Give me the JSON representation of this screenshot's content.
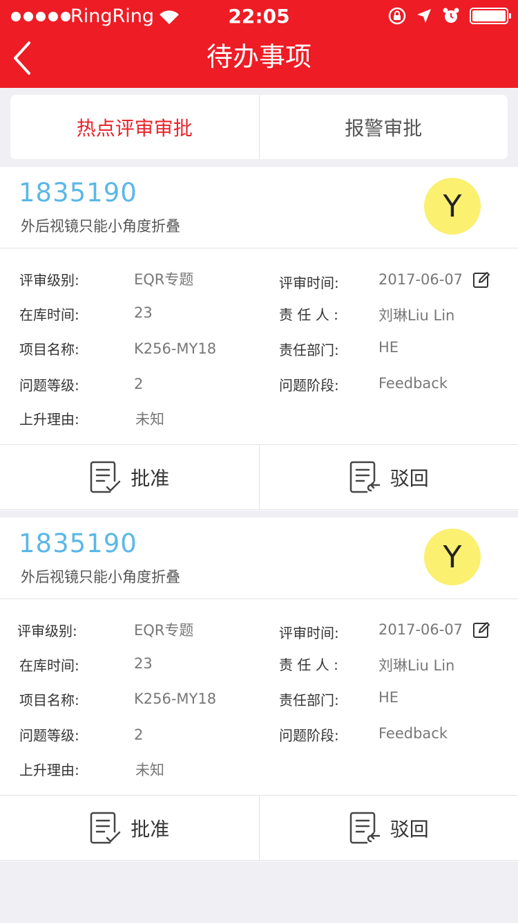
{
  "status": {
    "carrier": "RingRing",
    "time": "22:05"
  },
  "nav": {
    "title": "待办事项"
  },
  "tabs": [
    {
      "label": "热点评审审批"
    },
    {
      "label": "报警审批"
    }
  ],
  "labels": {
    "review_level": "评审级别:",
    "review_time": "评审时间:",
    "stock_time": "在库时间:",
    "owner": "责 任 人 :",
    "project_name": "项目名称:",
    "dept": "责任部门:",
    "issue_level": "问题等级:",
    "issue_stage": "问题阶段:",
    "escalation_reason": "上升理由:",
    "approve": "批准",
    "reject": "驳回"
  },
  "cards": [
    {
      "id": "1835190",
      "subtitle": "外后视镜只能小角度折叠",
      "avatar": "Y",
      "review_level": "EQR专题",
      "review_time": "2017-06-07",
      "stock_time": "23",
      "owner": "刘琳Liu Lin",
      "project_name": "K256-MY18",
      "dept": "HE",
      "issue_level": "2",
      "issue_stage": "Feedback",
      "escalation_reason": "未知"
    },
    {
      "id": "1835190",
      "subtitle": "外后视镜只能小角度折叠",
      "avatar": "Y",
      "review_level": "EQR专题",
      "review_time": "2017-06-07",
      "stock_time": "23",
      "owner": "刘琳Liu Lin",
      "project_name": "K256-MY18",
      "dept": "HE",
      "issue_level": "2",
      "issue_stage": "Feedback",
      "escalation_reason": "未知"
    }
  ],
  "colors": {
    "brand_red": "#ee1c25",
    "id_blue": "#5bb7e8",
    "avatar_yellow": "#fbf070"
  },
  "icons": [
    "back-chevron-icon",
    "wifi-icon",
    "rotation-lock-icon",
    "location-arrow-icon",
    "alarm-clock-icon",
    "battery-icon",
    "edit-icon",
    "approve-document-icon",
    "reject-document-icon"
  ]
}
